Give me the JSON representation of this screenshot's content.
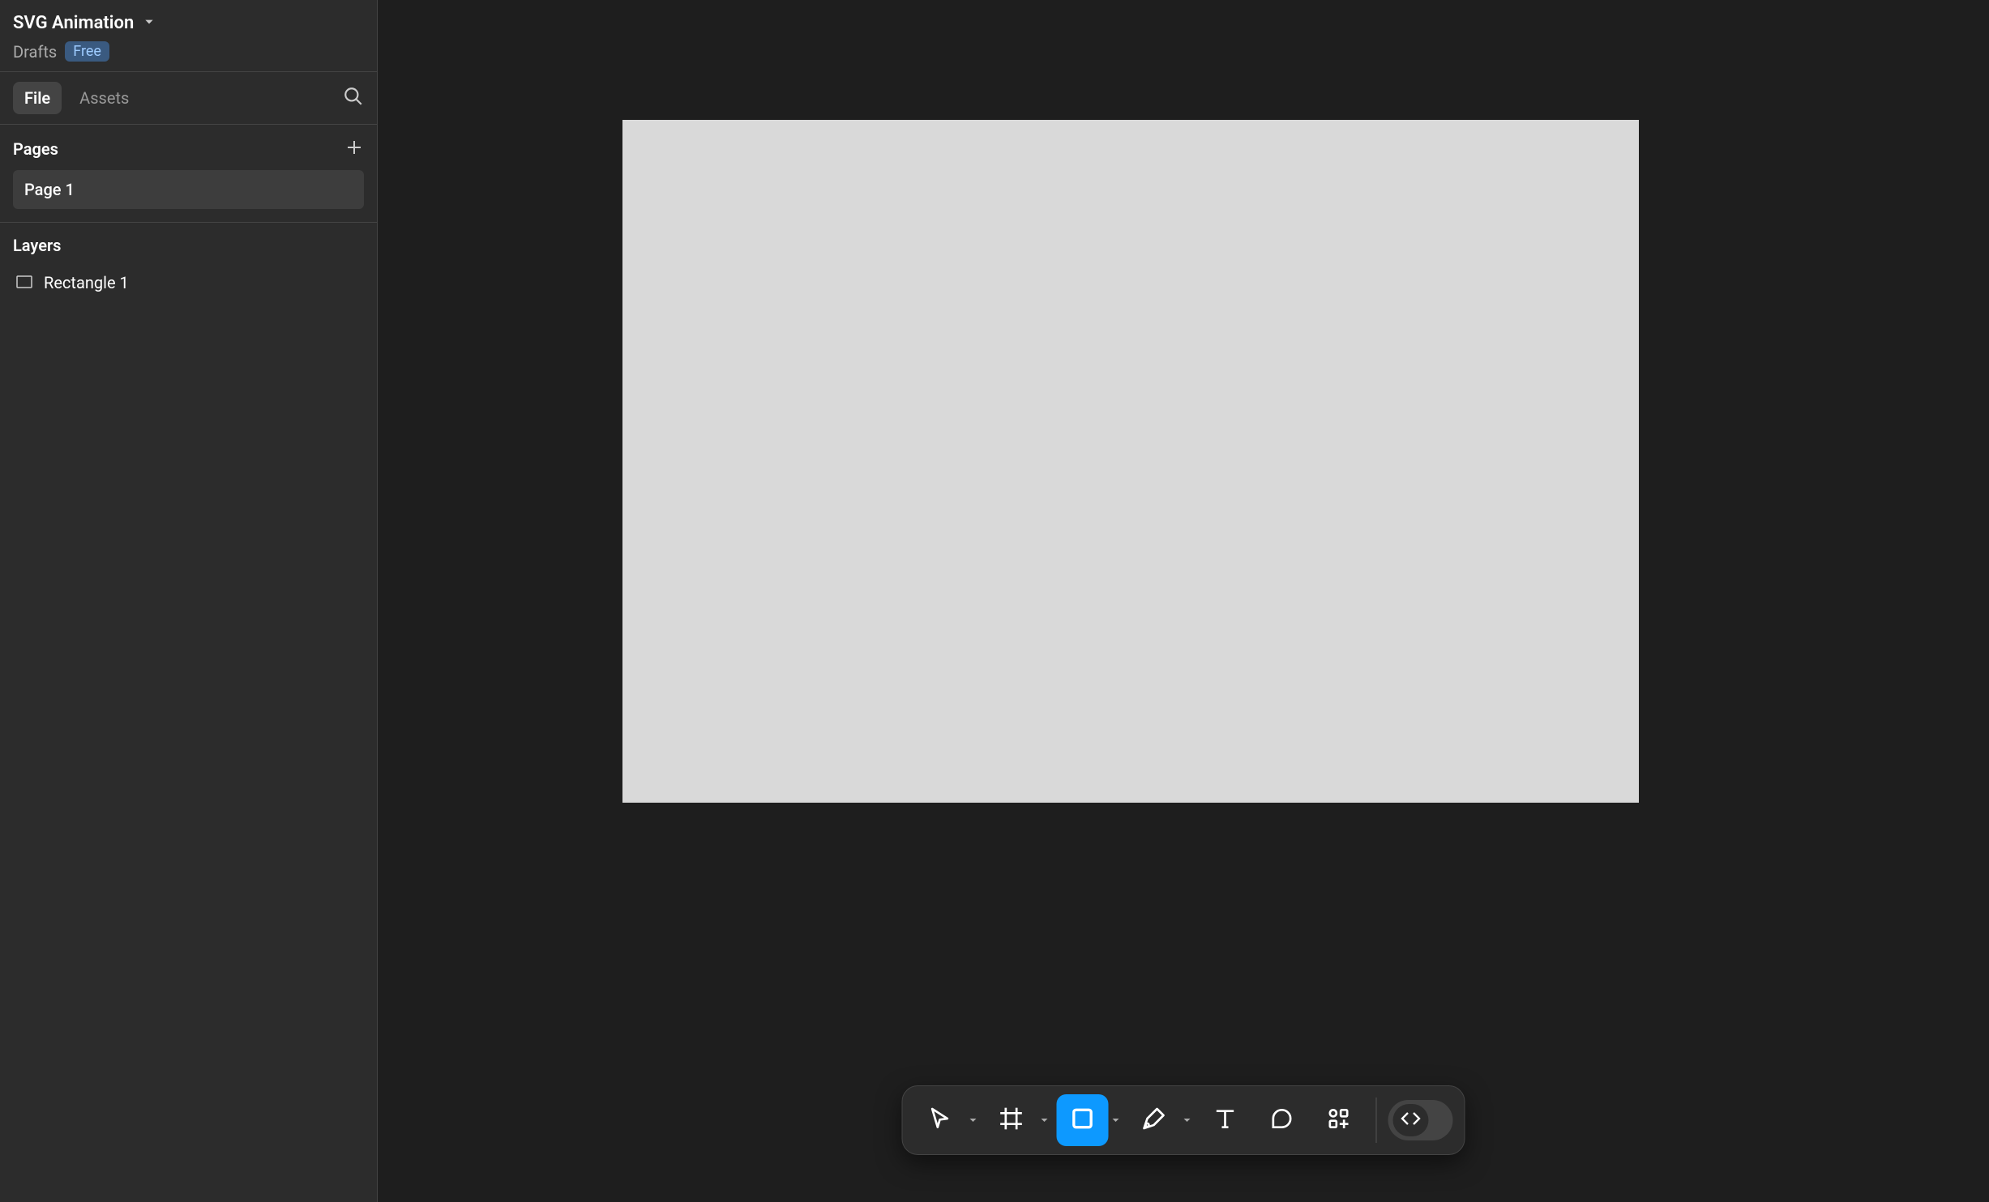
{
  "header": {
    "title": "SVG Animation",
    "drafts_label": "Drafts",
    "badge_label": "Free"
  },
  "tabs": {
    "file_label": "File",
    "assets_label": "Assets"
  },
  "pages": {
    "section_title": "Pages",
    "items": [
      {
        "label": "Page 1"
      }
    ]
  },
  "layers": {
    "section_title": "Layers",
    "items": [
      {
        "label": "Rectangle 1",
        "icon": "rectangle-icon"
      }
    ]
  },
  "canvas": {
    "rectangle_fill": "#d9d9d9"
  },
  "toolbar": {
    "tools": [
      {
        "name": "move-tool",
        "icon": "cursor-icon",
        "has_caret": true
      },
      {
        "name": "frame-tool",
        "icon": "frame-icon",
        "has_caret": true
      },
      {
        "name": "shape-tool",
        "icon": "rectangle-tool-icon",
        "has_caret": true,
        "active": true
      },
      {
        "name": "pen-tool",
        "icon": "pen-icon",
        "has_caret": true
      },
      {
        "name": "text-tool",
        "icon": "text-icon",
        "has_caret": false
      },
      {
        "name": "comment-tool",
        "icon": "comment-icon",
        "has_caret": false
      },
      {
        "name": "actions-tool",
        "icon": "actions-icon",
        "has_caret": false
      }
    ],
    "dev_mode": {
      "icon": "code-icon"
    }
  }
}
